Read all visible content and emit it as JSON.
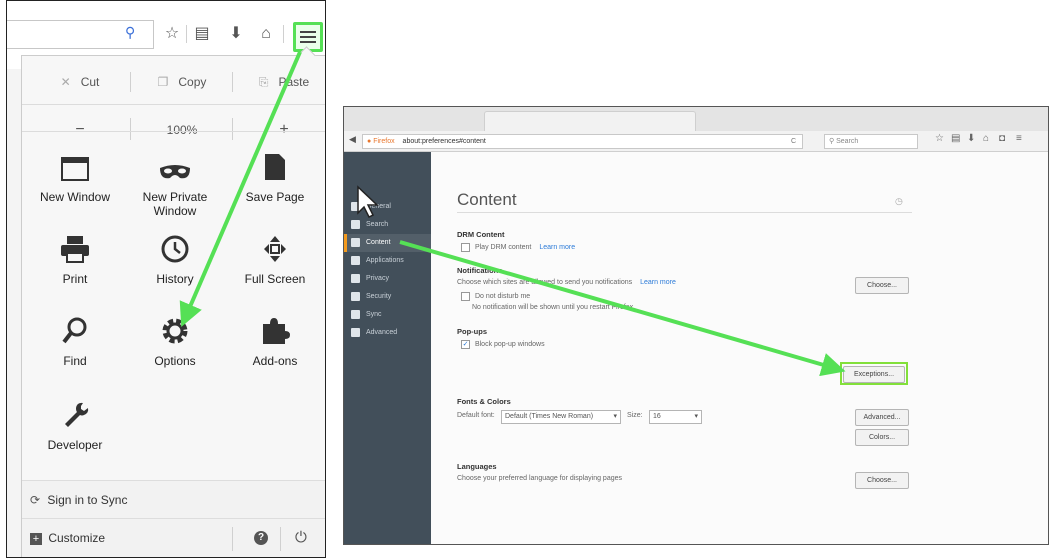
{
  "menu": {
    "edit": {
      "cut": "Cut",
      "copy": "Copy",
      "paste": "Paste"
    },
    "zoom": {
      "minus": "−",
      "level": "100%",
      "plus": "+"
    },
    "tiles": [
      {
        "label": "New Window",
        "icon": "new-window-icon"
      },
      {
        "label": "New Private Window",
        "icon": "private-mask-icon"
      },
      {
        "label": "Save Page",
        "icon": "save-page-icon"
      },
      {
        "label": "Print",
        "icon": "printer-icon"
      },
      {
        "label": "History",
        "icon": "clock-icon"
      },
      {
        "label": "Full Screen",
        "icon": "fullscreen-icon"
      },
      {
        "label": "Find",
        "icon": "magnifier-icon"
      },
      {
        "label": "Options",
        "icon": "gear-icon"
      },
      {
        "label": "Add-ons",
        "icon": "puzzle-icon"
      },
      {
        "label": "Developer",
        "icon": "wrench-icon"
      }
    ],
    "sync": "Sign in to Sync",
    "customize": "Customize"
  },
  "prefs": {
    "tab_text": "Firefox",
    "url": "about:preferences#content",
    "search_placeholder": "Search",
    "sidebar": [
      {
        "label": "General"
      },
      {
        "label": "Search"
      },
      {
        "label": "Content"
      },
      {
        "label": "Applications"
      },
      {
        "label": "Privacy"
      },
      {
        "label": "Security"
      },
      {
        "label": "Sync"
      },
      {
        "label": "Advanced"
      }
    ],
    "title": "Content",
    "drm": {
      "heading": "DRM Content",
      "option": "Play DRM content",
      "learn": "Learn more"
    },
    "notifications": {
      "heading": "Notifications",
      "desc": "Choose which sites are allowed to send you notifications",
      "learn": "Learn more",
      "choose": "Choose...",
      "dnd": "Do not disturb me",
      "dnd_note": "No notification will be shown until you restart Firefox"
    },
    "popups": {
      "heading": "Pop-ups",
      "block": "Block pop-up windows",
      "exceptions": "Exceptions..."
    },
    "fonts": {
      "heading": "Fonts & Colors",
      "default_font_label": "Default font:",
      "default_font_value": "Default (Times New Roman)",
      "size_label": "Size:",
      "size_value": "16",
      "advanced": "Advanced...",
      "colors": "Colors..."
    },
    "languages": {
      "heading": "Languages",
      "desc": "Choose your preferred language for displaying pages",
      "choose": "Choose..."
    }
  },
  "colors": {
    "highlight": "#55e055",
    "sidebar": "#424f5a",
    "active_accent": "#f39a1d"
  }
}
